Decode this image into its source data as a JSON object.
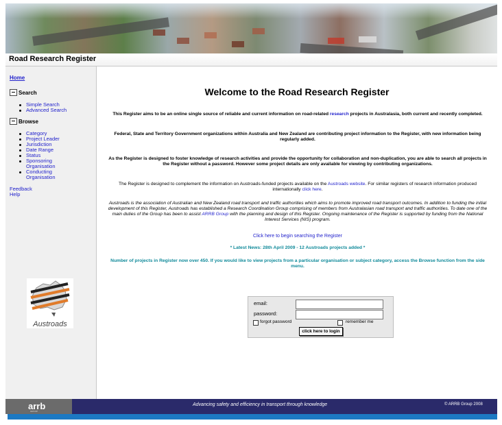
{
  "site_title": "Road Research Register",
  "nav": {
    "home": "Home",
    "search_heading": "Search",
    "search_items": [
      "Simple Search",
      "Advanced Search"
    ],
    "browse_heading": "Browse",
    "browse_items": [
      "Category",
      "Project Leader",
      "Jurisdiction",
      "Date Range",
      "Status",
      "Sponsoring",
      "Organisation",
      "Conducting",
      "Organisation"
    ],
    "feedback": "Feedback",
    "help": "Help",
    "logo_word": "Austroads"
  },
  "main": {
    "title": "Welcome to the Road Research Register",
    "p1_a": "This Register aims to be an online single source of reliable and current information on road-related",
    "p1_link": "research",
    "p1_b": "projects in Australasia, both current and recently completed.",
    "p2": "Federal, State and Territory Government organizations within Australia and New Zealand are contributing project information to the Register, with new information being regularly added.",
    "p3": "As the Register is designed to foster knowledge of research activities and provide the opportunity for collaboration and non-duplication, you are able to search all projects in the Register without a password. However some project details are only available for viewing by contributing organizations.",
    "p4_a": "The Register is designed to complement the information on Austroads-funded projects available on the",
    "p4_link1": "Austroads website",
    "p4_b": ". For similar registers of research information produced internationally",
    "p4_link2": "click here",
    "p4_c": ".",
    "p5_a": "Austroads is the association of Australian and New Zealand road transport and traffic authorities which aims to promote improved road transport outcomes. In addition to funding the initial development of this Register, Austroads has established a Research Coordination Group comprising of members from Australasian road transport and traffic authorities. To date one of the main duties of the Group has been to assist",
    "p5_link": "ARRB Group",
    "p5_b": "with the planning and design of this Register. Ongoing maintenance of the Register is supported by funding from the National Interest Services (NIS) program.",
    "begin_search": "Click here to begin searching the Register",
    "news": "* Latest News: 28th April 2009 - 12 Austroads projects added *",
    "count_note": "Number of projects in Register now over 450. If you would like to view projects from a particular organisation or subject category, access the Browse function from the side menu."
  },
  "login": {
    "email_label": "email:",
    "email_value": "",
    "password_label": "password:",
    "password_value": "",
    "forgot": "forgot password",
    "remember": "remember me",
    "button": "click here to login"
  },
  "footer": {
    "brand": "arrb",
    "brand_sub": "GROUP",
    "tagline": "Advancing safety and efficiency in transport through knowledge",
    "copyright": "© ARRB Group 2008"
  },
  "colors": {
    "frame": "#1c79c3",
    "footer": "#2a2a6a",
    "link": "#2222cc",
    "teal": "#108a9a"
  }
}
